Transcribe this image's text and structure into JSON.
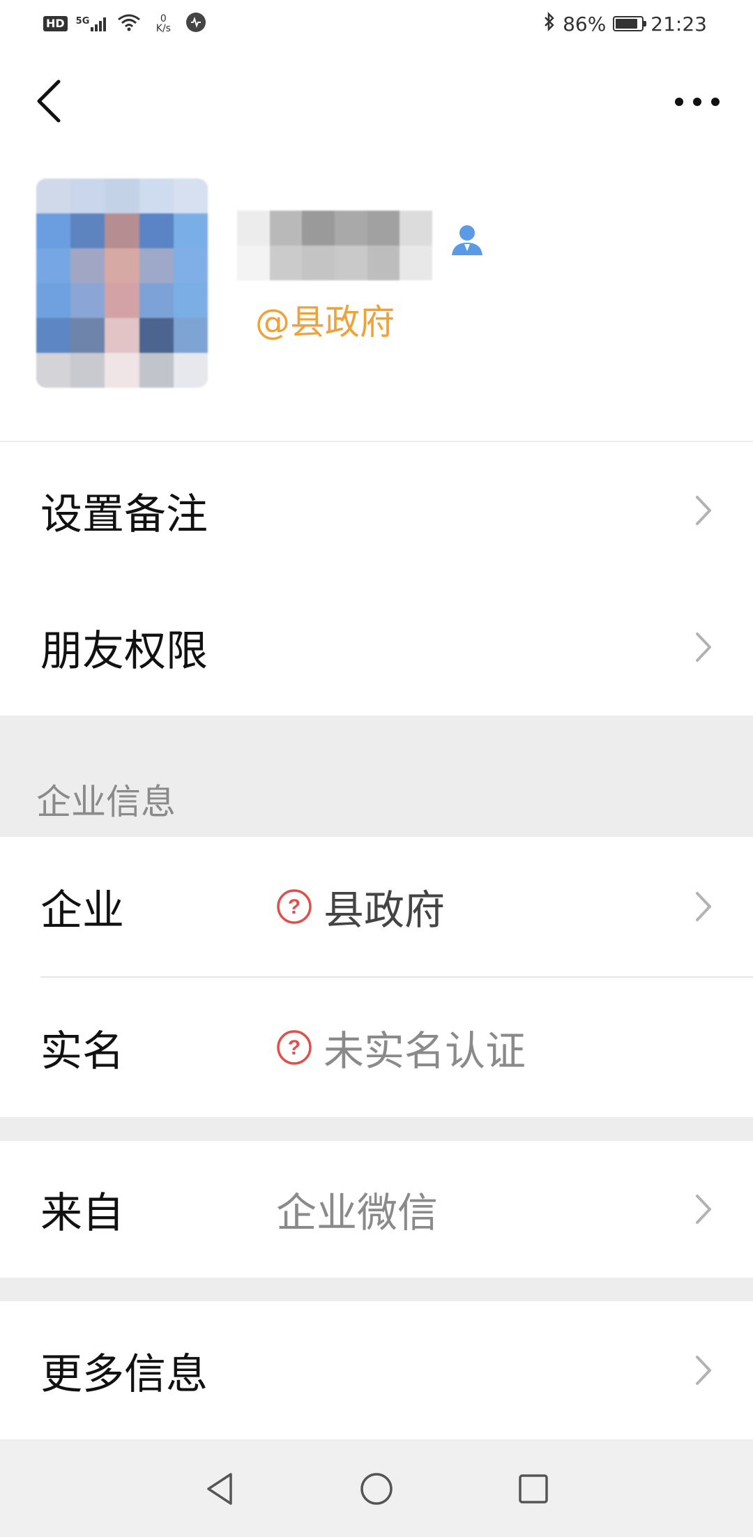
{
  "status_bar": {
    "hd": "HD",
    "network": "5G",
    "speed_value": "0",
    "speed_unit": "K/s",
    "battery_percent": "86%",
    "time": "21:23",
    "battery_level": 0.86
  },
  "nav": {
    "back_icon": "chevron-left-icon",
    "more_icon": "more-dots-icon"
  },
  "profile": {
    "org_tag": "@县政府",
    "contact_icon": "enterprise-contact-icon"
  },
  "menu": {
    "remark_label": "设置备注",
    "permission_label": "朋友权限"
  },
  "enterprise": {
    "section_title": "企业信息",
    "company_label": "企业",
    "company_value": "县政府",
    "realname_label": "实名",
    "realname_value": "未实名认证"
  },
  "source": {
    "label": "来自",
    "value": "企业微信"
  },
  "more": {
    "label": "更多信息"
  },
  "colors": {
    "org_tag": "#f0a23a",
    "help_icon": "#e0504a",
    "background": "#ededed"
  }
}
